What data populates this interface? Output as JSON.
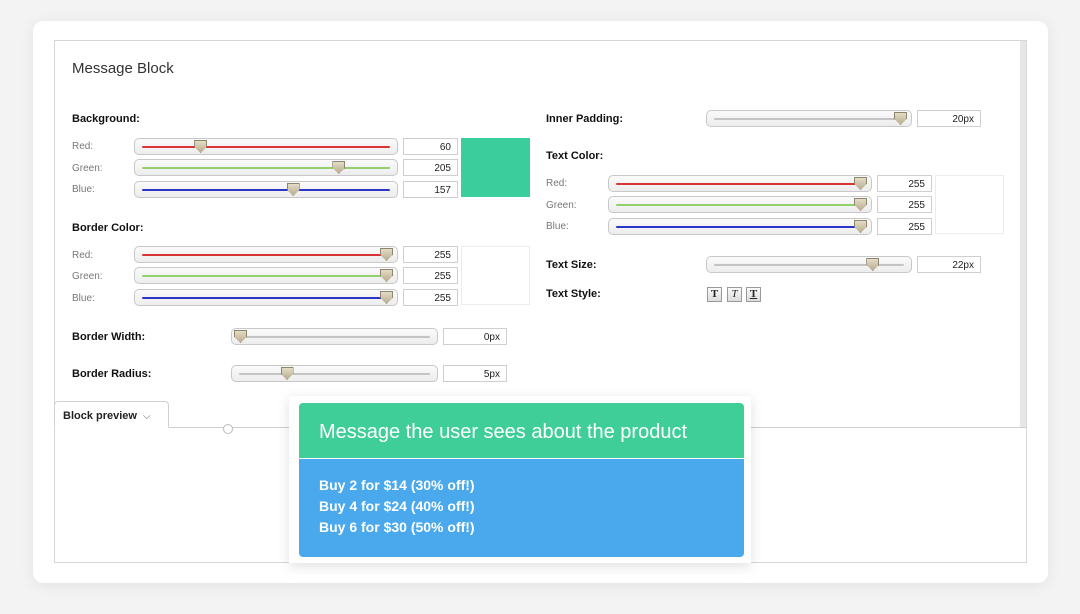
{
  "panel": {
    "title": "Message Block"
  },
  "background": {
    "label": "Background:",
    "channels": [
      {
        "label": "Red:",
        "value": "60",
        "fraction": 0.235
      },
      {
        "label": "Green:",
        "value": "205",
        "fraction": 0.804
      },
      {
        "label": "Blue:",
        "value": "157",
        "fraction": 0.616
      }
    ],
    "swatch_color": "#3ccd9d"
  },
  "border_color": {
    "label": "Border Color:",
    "channels": [
      {
        "label": "Red:",
        "value": "255",
        "fraction": 1
      },
      {
        "label": "Green:",
        "value": "255",
        "fraction": 1
      },
      {
        "label": "Blue:",
        "value": "255",
        "fraction": 1
      }
    ],
    "swatch_color": "#ffffff"
  },
  "border_width": {
    "label": "Border Width:",
    "value": "0px",
    "fraction": 0
  },
  "border_radius": {
    "label": "Border Radius:",
    "value": "5px",
    "fraction": 0.25
  },
  "inner_padding": {
    "label": "Inner Padding:",
    "value": "20px",
    "fraction": 1
  },
  "text_color": {
    "label": "Text Color:",
    "channels": [
      {
        "label": "Red:",
        "value": "255",
        "fraction": 1
      },
      {
        "label": "Green:",
        "value": "255",
        "fraction": 1
      },
      {
        "label": "Blue:",
        "value": "255",
        "fraction": 1
      }
    ],
    "swatch_color": "#ffffff"
  },
  "text_size": {
    "label": "Text Size:",
    "value": "22px",
    "fraction": 0.85
  },
  "text_style": {
    "label": "Text Style:",
    "buttons": [
      {
        "glyph": "T",
        "name": "bold"
      },
      {
        "glyph": "T",
        "name": "italic"
      },
      {
        "glyph": "T",
        "name": "underline"
      }
    ]
  },
  "preview_tab": {
    "label": "Block preview",
    "chevron": "⌵"
  },
  "preview": {
    "header": "Message the user sees about the product",
    "lines": [
      "Buy 2 for $14 (30% off!)",
      "Buy 4 for $24 (40% off!)",
      "Buy 6 for $30 (50% off!)"
    ],
    "header_color": "#3fce98",
    "body_color": "#4aa8ed"
  }
}
